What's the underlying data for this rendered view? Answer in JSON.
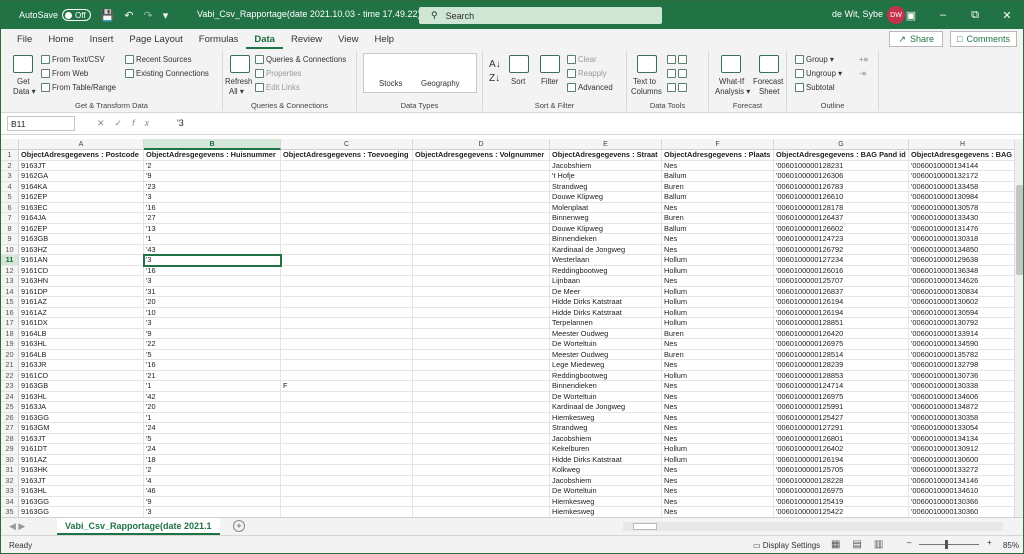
{
  "titlebar": {
    "autosave": "AutoSave",
    "toggle": "Off",
    "doc_title": "Vabi_Csv_Rapportage(date 2021.10.03 - time 17.49.22) ▾",
    "search_placeholder": "Search",
    "user": "de Wit, Sybe",
    "avatar": "DW"
  },
  "menu": {
    "tabs": [
      "File",
      "Home",
      "Insert",
      "Page Layout",
      "Formulas",
      "Data",
      "Review",
      "View",
      "Help"
    ],
    "share": "Share",
    "comments": "Comments"
  },
  "ribbon": {
    "get_data_1": "Get",
    "get_data_2": "Data ▾",
    "from_text": "From Text/CSV",
    "from_web": "From Web",
    "from_table": "From Table/Range",
    "recent": "Recent Sources",
    "existing": "Existing Connections",
    "g1": "Get & Transform Data",
    "refresh_1": "Refresh",
    "refresh_2": "All ▾",
    "queries": "Queries & Connections",
    "properties": "Properties",
    "editlinks": "Edit Links",
    "g2": "Queries & Connections",
    "stocks": "Stocks",
    "geography": "Geography",
    "g3": "Data Types",
    "sort": "Sort",
    "filter": "Filter",
    "clear": "Clear",
    "reapply": "Reapply",
    "advanced": "Advanced",
    "g4": "Sort & Filter",
    "t2c_1": "Text to",
    "t2c_2": "Columns",
    "g5": "Data Tools",
    "whatif_1": "What-If",
    "whatif_2": "Analysis ▾",
    "forecast_1": "Forecast",
    "forecast_2": "Sheet",
    "g6": "Forecast",
    "group": "Group ▾",
    "ungroup": "Ungroup ▾",
    "subtotal": "Subtotal",
    "g7": "Outline"
  },
  "formula": {
    "namebox": "B11",
    "value": "'3"
  },
  "sheet": {
    "columns": [
      "A",
      "B",
      "C",
      "D",
      "E",
      "F",
      "G",
      "H"
    ],
    "headers": [
      "ObjectAdresgegevens : Postcode",
      "ObjectAdresgegevens : Huisnummer",
      "ObjectAdresgegevens : Toevoeging",
      "ObjectAdresgegevens : Volgnummer",
      "ObjectAdresgegevens : Straat",
      "ObjectAdresgegevens : Plaats",
      "ObjectAdresgegevens : BAG Pand id",
      "ObjectAdresgegevens : BAG"
    ],
    "rows": [
      [
        "9163JT",
        "'2",
        "",
        "",
        "Jacobshiem",
        "Nes",
        "'0060100000128231",
        "'0060010000134144"
      ],
      [
        "9162GA",
        "'9",
        "",
        "",
        "'t Hofje",
        "Ballum",
        "'0060100000126306",
        "'0060010000132172"
      ],
      [
        "9164KA",
        "'23",
        "",
        "",
        "Strandweg",
        "Buren",
        "'0060100000126783",
        "'0060010000133458"
      ],
      [
        "9162EP",
        "'3",
        "",
        "",
        "Douwe Klipweg",
        "Ballum",
        "'0060100000126610",
        "'0060010000130984"
      ],
      [
        "9163EC",
        "'16",
        "",
        "",
        "Molenplaat",
        "Nes",
        "'0060100000128178",
        "'0060010000130578"
      ],
      [
        "9164JA",
        "'27",
        "",
        "",
        "Binnenweg",
        "Buren",
        "'0060100000126437",
        "'0060010000133430"
      ],
      [
        "9162EP",
        "'13",
        "",
        "",
        "Douwe Klipweg",
        "Ballum",
        "'0060100000126602",
        "'0060010000131476"
      ],
      [
        "9163GB",
        "'1",
        "",
        "",
        "Binnendieken",
        "Nes",
        "'0060100000124723",
        "'0060010000130318"
      ],
      [
        "9163HZ",
        "'43",
        "",
        "",
        "Kardinaal de Jongweg",
        "Nes",
        "'0060100000126792",
        "'0060010000134850"
      ],
      [
        "9161AN",
        "'3",
        "",
        "",
        "Westerlaan",
        "Hollum",
        "'0060100000127234",
        "'0060010000129638"
      ],
      [
        "9161CD",
        "'16",
        "",
        "",
        "Reddingbootweg",
        "Hollum",
        "'0060100000126016",
        "'0060010000136348"
      ],
      [
        "9163HN",
        "'3",
        "",
        "",
        "Lijnbaan",
        "Nes",
        "'0060100000125707",
        "'0060010000134626"
      ],
      [
        "9161DP",
        "'31",
        "",
        "",
        "De Meer",
        "Hollum",
        "'0060100000126837",
        "'0060010000130834"
      ],
      [
        "9161AZ",
        "'20",
        "",
        "",
        "Hidde Dirks Katstraat",
        "Hollum",
        "'0060100000126194",
        "'0060010000130602"
      ],
      [
        "9161AZ",
        "'10",
        "",
        "",
        "Hidde Dirks Katstraat",
        "Hollum",
        "'0060100000126194",
        "'0060010000130594"
      ],
      [
        "9161DX",
        "'3",
        "",
        "",
        "Terpelannen",
        "Hollum",
        "'0060100000128851",
        "'0060010000130792"
      ],
      [
        "9164LB",
        "'9",
        "",
        "",
        "Meester Oudweg",
        "Buren",
        "'0060100000126420",
        "'0060010000133914"
      ],
      [
        "9163HL",
        "'22",
        "",
        "",
        "De Worteltuin",
        "Nes",
        "'0060100000126975",
        "'0060010000134590"
      ],
      [
        "9164LB",
        "'5",
        "",
        "",
        "Meester Oudweg",
        "Buren",
        "'0060100000128514",
        "'0060010000135782"
      ],
      [
        "9163JR",
        "'16",
        "",
        "",
        "Lege Miedeweg",
        "Nes",
        "'0060100000128239",
        "'0060010000132798"
      ],
      [
        "9161CD",
        "'21",
        "",
        "",
        "Reddingbootweg",
        "Hollum",
        "'0060100000128853",
        "'0060010000130736"
      ],
      [
        "9163GB",
        "'1",
        "F",
        "",
        "Binnendieken",
        "Nes",
        "'0060100000124714",
        "'0060010000130338"
      ],
      [
        "9163HL",
        "'42",
        "",
        "",
        "De Worteltuin",
        "Nes",
        "'0060100000126975",
        "'0060010000134606"
      ],
      [
        "9163JA",
        "'20",
        "",
        "",
        "Kardinaal de Jongweg",
        "Nes",
        "'0060100000125991",
        "'0060010000134872"
      ],
      [
        "9163GG",
        "'1",
        "",
        "",
        "Hiemkesweg",
        "Nes",
        "'0060100000125427",
        "'0060010000130358"
      ],
      [
        "9163GM",
        "'24",
        "",
        "",
        "Strandweg",
        "Nes",
        "'0060100000127291",
        "'0060010000133054"
      ],
      [
        "9163JT",
        "'5",
        "",
        "",
        "Jacobshiem",
        "Nes",
        "'0060100000126801",
        "'0060010000134134"
      ],
      [
        "9161DT",
        "'24",
        "",
        "",
        "Kekelburen",
        "Hollum",
        "'0060100000126402",
        "'0060010000130912"
      ],
      [
        "9161AZ",
        "'18",
        "",
        "",
        "Hidde Dirks Katstraat",
        "Hollum",
        "'0060100000126194",
        "'0060010000130600"
      ],
      [
        "9163HK",
        "'2",
        "",
        "",
        "Kolkweg",
        "Nes",
        "'0060100000125705",
        "'0060010000133272"
      ],
      [
        "9163JT",
        "'4",
        "",
        "",
        "Jacobshiem",
        "Nes",
        "'0060100000128228",
        "'0060010000134146"
      ],
      [
        "9163HL",
        "'46",
        "",
        "",
        "De Worteltuin",
        "Nes",
        "'0060100000126975",
        "'0060010000134610"
      ],
      [
        "9163GG",
        "'9",
        "",
        "",
        "Hiemkesweg",
        "Nes",
        "'0060100000125419",
        "'0060010000130366"
      ],
      [
        "9163GG",
        "'3",
        "",
        "",
        "Hiemkesweg",
        "Nes",
        "'0060100000125422",
        "'0060010000130360"
      ]
    ]
  },
  "sheetbar": {
    "tab": "Vabi_Csv_Rapportage(date 2021.1"
  },
  "status": {
    "ready": "Ready",
    "display": "Display Settings",
    "zoom": "85%"
  }
}
